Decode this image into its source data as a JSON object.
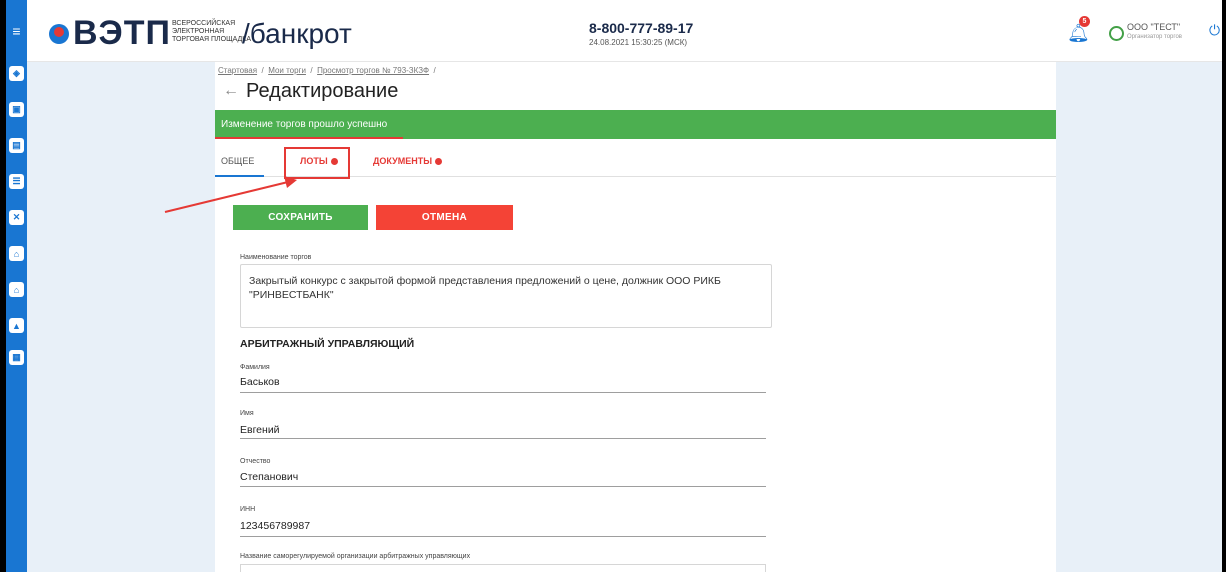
{
  "header": {
    "logo_text": "ВЭТП",
    "logo_sub_line1": "ВСЕРОССИЙСКАЯ",
    "logo_sub_line2": "ЭЛЕКТРОННАЯ",
    "logo_sub_line3": "ТОРГОВАЯ ПЛОЩАДКА",
    "section": "/банкрот",
    "phone": "8-800-777-89-17",
    "datetime": "24.08.2021 15:30:25 (МСК)",
    "notifications_count": "5",
    "user_name": "ООО \"ТЕСТ\"",
    "user_role": "Организатор торгов"
  },
  "breadcrumb": {
    "item1": "Стартовая",
    "sep": "/",
    "item2": "Мои торги",
    "item3": "Просмотр торгов № 793-ЗКЗФ"
  },
  "page": {
    "title": "Редактирование"
  },
  "alert": {
    "text": "Изменение торгов прошло успешно"
  },
  "tabs": {
    "general": "ОБЩЕЕ",
    "lots": "ЛОТЫ",
    "documents": "ДОКУМЕНТЫ"
  },
  "buttons": {
    "save": "СОХРАНИТЬ",
    "cancel": "ОТМЕНА"
  },
  "form": {
    "trade_name_label": "Наименование торгов",
    "trade_name_value": "Закрытый конкурс с закрытой формой представления предложений о цене, должник ООО РИКБ \"РИНВЕСТБАНК\"",
    "section_manager": "АРБИТРАЖНЫЙ УПРАВЛЯЮЩИЙ",
    "last_name_label": "Фамилия",
    "last_name_value": "Баськов",
    "first_name_label": "Имя",
    "first_name_value": "Евгений",
    "middle_name_label": "Отчество",
    "middle_name_value": "Степанович",
    "inn_label": "ИНН",
    "inn_value": "123456789987",
    "sro_label": "Название саморегулируемой организации арбитражных управляющих"
  },
  "colors": {
    "primary": "#1976d2",
    "success": "#4caf50",
    "danger": "#f44336",
    "annotation": "#e53935"
  }
}
